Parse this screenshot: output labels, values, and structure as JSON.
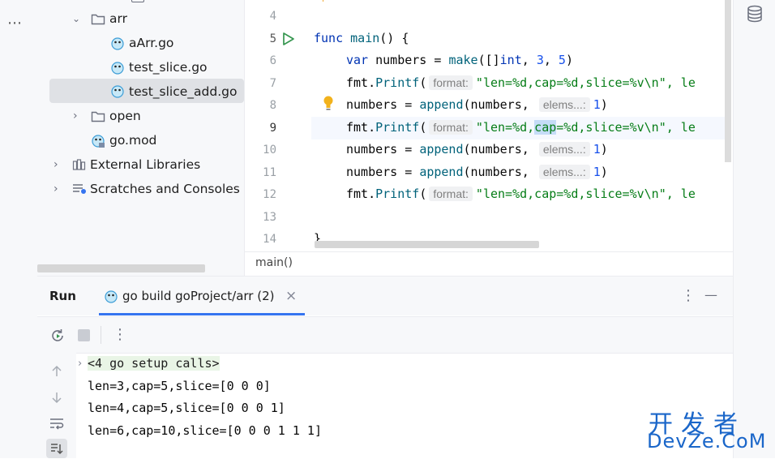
{
  "left_strip": {
    "more_icon": "more-horizontal-icon",
    "dots": "⋯"
  },
  "tree": {
    "items": [
      {
        "label": "arr",
        "type": "folder-expanded"
      },
      {
        "label": "aArr.go",
        "type": "go-file"
      },
      {
        "label": "test_slice.go",
        "type": "go-file"
      },
      {
        "label": "test_slice_add.go",
        "type": "go-file",
        "selected": true
      },
      {
        "label": "open",
        "type": "folder-collapsed"
      },
      {
        "label": "go.mod",
        "type": "go-mod"
      },
      {
        "label": "External Libraries",
        "type": "libraries"
      },
      {
        "label": "Scratches and Consoles",
        "type": "scratches"
      }
    ]
  },
  "editor": {
    "line_numbers": [
      "4",
      "5",
      "6",
      "7",
      "8",
      "9",
      "10",
      "11",
      "12",
      "13",
      "14"
    ],
    "lines": {
      "l5_a": "func ",
      "l5_b": "main",
      "l5_c": "() {",
      "l6_a": "var ",
      "l6_b": "numbers = ",
      "l6_c": "make",
      "l6_d": "([]",
      "l6_e": "int",
      "l6_f": ", ",
      "l6_g": "3",
      "l6_h": ", ",
      "l6_i": "5",
      "l6_j": ")",
      "printf_pkg": "fmt.",
      "printf_fn": "Printf",
      "paren": "(",
      "hint_format": "format:",
      "str7": "\"len=%d,cap=%d,slice=%v\\n\", le",
      "str9_a": "\"len=%d,",
      "str9_hl": "cap",
      "str9_b": "=%d,slice=%v\\n\", le",
      "append_a": "numbers = ",
      "append_fn": "append",
      "append_b": "(numbers, ",
      "hint_elems": "elems...:",
      "append_num": "1",
      "append_close": ")",
      "l14": "}"
    },
    "breadcrumb": "main()"
  },
  "run": {
    "title": "Run",
    "tab_label": "go build goProject/arr (2)",
    "close": "×",
    "more": "⋮",
    "minimize": "—",
    "console": {
      "setup_calls": "<4 go setup calls>",
      "lines": [
        "len=3,cap=5,slice=[0 0 0]",
        "len=4,cap=5,slice=[0 0 0 1]",
        "len=6,cap=10,slice=[0 0 0 1 1 1]"
      ]
    }
  },
  "watermark": {
    "top": "开发者",
    "bottom": "DevZe.CoM"
  },
  "colors": {
    "keyword": "#0033b3",
    "function": "#00627a",
    "string": "#067d17",
    "number": "#1750eb",
    "accent": "#3574f0"
  }
}
